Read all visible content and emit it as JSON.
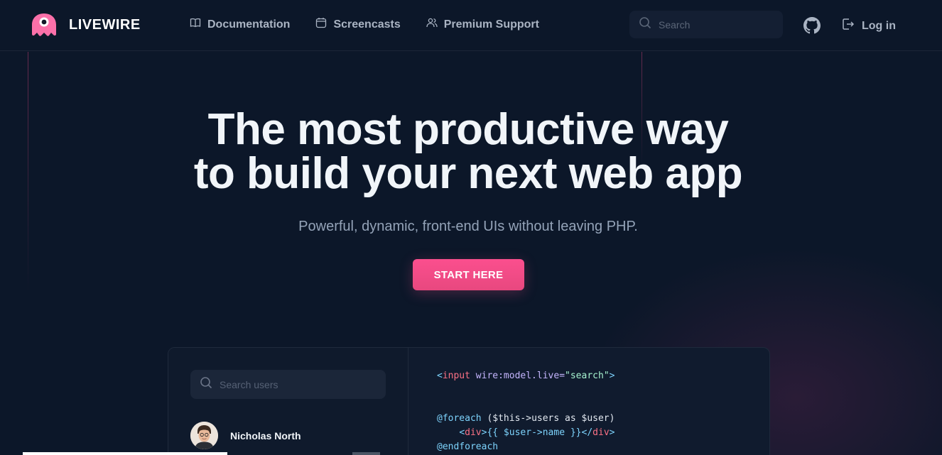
{
  "brand": {
    "name": "LIVEWIRE",
    "accent": "#fb5090"
  },
  "nav": {
    "items": [
      {
        "label": "Documentation",
        "icon": "book-icon"
      },
      {
        "label": "Screencasts",
        "icon": "calendar-icon"
      },
      {
        "label": "Premium Support",
        "icon": "users-icon"
      }
    ]
  },
  "search": {
    "placeholder": "Search"
  },
  "auth": {
    "login_label": "Log in"
  },
  "hero": {
    "title_line1": "The most productive way",
    "title_line2": "to build your next web app",
    "subtitle": "Powerful, dynamic, front-end UIs without leaving PHP.",
    "cta_label": "START HERE"
  },
  "demo": {
    "user_search_placeholder": "Search users",
    "users": [
      {
        "name": "Nicholas North"
      }
    ],
    "code": {
      "l1_open": "<",
      "l1_tag": "input",
      "l1_attr": " wire:model.live=",
      "l1_str": "\"search\"",
      "l1_close": ">",
      "l2_directive": "@foreach",
      "l2_rest": " ($this->users as $user)",
      "l3_open": "<",
      "l3_tag": "div",
      "l3_close": ">",
      "l3_expr": "{{ $user->name }}",
      "l3_end_open": "</",
      "l3_end_tag": "div",
      "l3_end_close": ">",
      "l4_directive": "@endforeach"
    }
  }
}
